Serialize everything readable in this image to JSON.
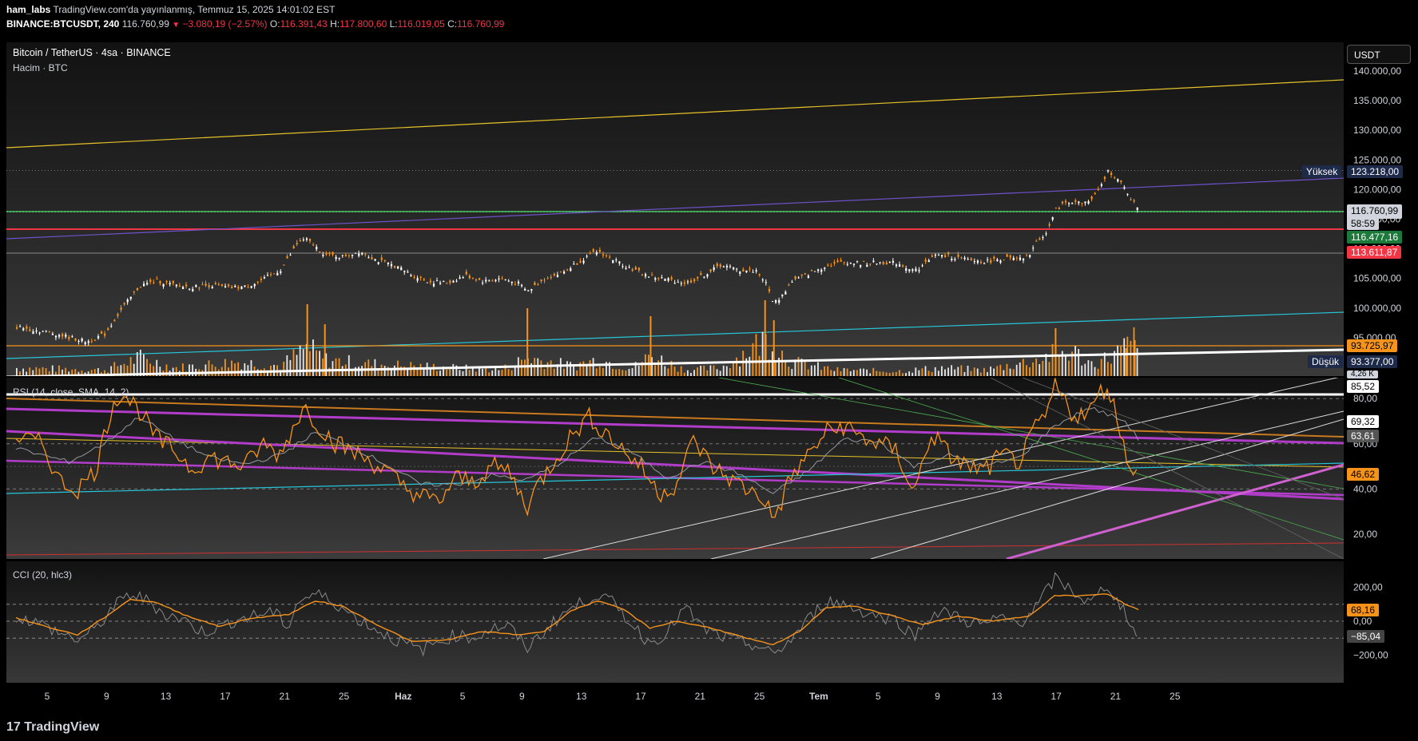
{
  "header": {
    "author": "ham_labs",
    "published": "TradingView.com'da yayınlanmış, Temmuz 15, 2025 14:01:02 EST",
    "symbol": "BINANCE:BTCUSDT, 240",
    "last": "116.760,99",
    "change": "−3.080,19 (−2.57%)",
    "o_label": "O:",
    "o_value": "116.391,43",
    "h_label": "H:",
    "h_value": "117.800,60",
    "l_label": "L:",
    "l_value": "116.019,05",
    "c_label": "C:",
    "c_value": "116.760,99"
  },
  "pane_titles": {
    "main": "Bitcoin / TetherUS · 4sa · BINANCE",
    "volume": "Hacim · BTC",
    "rsi": "RSI (14, close, SMA, 14, 2)",
    "cci": "CCI (20, hlc3)"
  },
  "currency_button": "USDT",
  "logo": "TradingView",
  "colors": {
    "candle_up": "#ffffff",
    "candle_down": "#f7931a",
    "price_line": "#22c55e",
    "resistance": "#f23645",
    "upper_channel": "#e6c229",
    "mid_channel": "#6e52c9",
    "lower_channel": "#26c6da",
    "rsi_line": "#f7931a",
    "rsi_ma": "#9598a1",
    "purple_trend": "#b13cc9"
  },
  "price_labels": {
    "yuksek_tag": "Yüksek",
    "yuksek_value": "123.218,00",
    "last": "116.760,99",
    "countdown": "58:59",
    "green": "116.477,16",
    "red": "113.611,87",
    "orange": "93.725,97",
    "dusuk_tag": "Düşük",
    "dusuk_value": "93.377,00",
    "volume_partial": "4,26 K"
  },
  "rsi_labels": {
    "white": "85,52",
    "light": "69,32",
    "gray": "63,61",
    "orange": "46,62"
  },
  "cci_labels": {
    "orange": "68,16",
    "gray": "−85,04"
  },
  "chart_data": {
    "type": "line",
    "title": "Bitcoin / TetherUS · 4sa · BINANCE",
    "price_axis": {
      "ticks": [
        "140.000,00",
        "135.000,00",
        "130.000,00",
        "125.000,00",
        "120.000,00",
        "115.000,00",
        "110.000,00",
        "105.000,00",
        "100.000,00",
        "95.000,00"
      ],
      "values": [
        140000,
        135000,
        130000,
        125000,
        120000,
        115000,
        110000,
        105000,
        100000,
        95000
      ]
    },
    "rsi_axis": {
      "ticks": [
        "80,00",
        "60,00",
        "40,00",
        "20,00"
      ],
      "values": [
        80,
        60,
        40,
        20
      ]
    },
    "cci_axis": {
      "ticks": [
        "200,00",
        "0,00",
        "−200,00"
      ],
      "values": [
        200,
        0,
        -200
      ]
    },
    "date_ticks": [
      "5",
      "9",
      "13",
      "17",
      "21",
      "25",
      "Haz",
      "5",
      "9",
      "13",
      "17",
      "21",
      "25",
      "Tem",
      "5",
      "9",
      "13",
      "17",
      "21",
      "25"
    ],
    "price_series": [
      [
        0,
        96800
      ],
      [
        4,
        95800
      ],
      [
        8,
        94300
      ],
      [
        10,
        95600
      ],
      [
        12,
        100000
      ],
      [
        14,
        103800
      ],
      [
        16,
        104600
      ],
      [
        18,
        103800
      ],
      [
        20,
        103500
      ],
      [
        22,
        103900
      ],
      [
        24,
        103400
      ],
      [
        26,
        103600
      ],
      [
        28,
        104800
      ],
      [
        30,
        106500
      ],
      [
        32,
        111200
      ],
      [
        33,
        111500
      ],
      [
        35,
        109000
      ],
      [
        37,
        108700
      ],
      [
        39,
        109600
      ],
      [
        41,
        108000
      ],
      [
        43,
        107100
      ],
      [
        45,
        105500
      ],
      [
        47,
        104400
      ],
      [
        49,
        104300
      ],
      [
        51,
        105500
      ],
      [
        53,
        104500
      ],
      [
        55,
        105000
      ],
      [
        57,
        104100
      ],
      [
        58,
        102800
      ],
      [
        60,
        105000
      ],
      [
        62,
        106000
      ],
      [
        64,
        108000
      ],
      [
        66,
        109600
      ],
      [
        68,
        108000
      ],
      [
        70,
        106500
      ],
      [
        72,
        105300
      ],
      [
        74,
        104800
      ],
      [
        76,
        104200
      ],
      [
        78,
        105500
      ],
      [
        80,
        107300
      ],
      [
        82,
        106400
      ],
      [
        84,
        106300
      ],
      [
        85,
        104500
      ],
      [
        86,
        100800
      ],
      [
        87,
        102200
      ],
      [
        88,
        104500
      ],
      [
        90,
        105800
      ],
      [
        92,
        107200
      ],
      [
        94,
        107800
      ],
      [
        96,
        107500
      ],
      [
        98,
        107700
      ],
      [
        100,
        107600
      ],
      [
        102,
        106300
      ],
      [
        103,
        107200
      ],
      [
        104,
        108900
      ],
      [
        106,
        108700
      ],
      [
        108,
        108100
      ],
      [
        110,
        107800
      ],
      [
        112,
        108400
      ],
      [
        114,
        108200
      ],
      [
        115,
        109000
      ],
      [
        116,
        111500
      ],
      [
        117,
        112800
      ],
      [
        118,
        116500
      ],
      [
        119,
        117800
      ],
      [
        120,
        118000
      ],
      [
        121,
        117600
      ],
      [
        122,
        118200
      ],
      [
        123,
        120000
      ],
      [
        124,
        123218
      ],
      [
        125,
        121800
      ],
      [
        126,
        119800
      ],
      [
        127,
        117500
      ],
      [
        127.5,
        116761
      ]
    ],
    "volume_hint": [
      [
        0,
        0.2
      ],
      [
        10,
        0.15
      ],
      [
        14,
        0.45
      ],
      [
        18,
        0.2
      ],
      [
        25,
        0.35
      ],
      [
        30,
        0.25
      ],
      [
        33,
        0.7
      ],
      [
        35,
        0.4
      ],
      [
        40,
        0.3
      ],
      [
        45,
        0.25
      ],
      [
        50,
        0.2
      ],
      [
        55,
        0.15
      ],
      [
        58,
        0.45
      ],
      [
        63,
        0.25
      ],
      [
        66,
        0.4
      ],
      [
        70,
        0.2
      ],
      [
        72,
        0.5
      ],
      [
        76,
        0.15
      ],
      [
        80,
        0.2
      ],
      [
        85,
        0.9
      ],
      [
        86,
        0.75
      ],
      [
        88,
        0.35
      ],
      [
        93,
        0.15
      ],
      [
        100,
        0.12
      ],
      [
        105,
        0.2
      ],
      [
        110,
        0.15
      ],
      [
        116,
        0.4
      ],
      [
        118,
        0.55
      ],
      [
        120,
        0.6
      ],
      [
        122,
        0.3
      ],
      [
        124,
        0.45
      ],
      [
        126,
        0.7
      ],
      [
        127,
        0.9
      ],
      [
        127.5,
        0.3
      ]
    ],
    "rsi_series": [
      [
        0,
        63
      ],
      [
        3,
        60
      ],
      [
        5,
        43
      ],
      [
        7,
        40
      ],
      [
        9,
        48
      ],
      [
        11,
        78
      ],
      [
        12,
        83
      ],
      [
        14,
        75
      ],
      [
        16,
        62
      ],
      [
        18,
        57
      ],
      [
        20,
        49
      ],
      [
        22,
        54
      ],
      [
        24,
        52
      ],
      [
        26,
        50
      ],
      [
        28,
        60
      ],
      [
        30,
        55
      ],
      [
        32,
        72
      ],
      [
        33,
        76
      ],
      [
        34,
        70
      ],
      [
        36,
        61
      ],
      [
        38,
        57
      ],
      [
        40,
        53
      ],
      [
        42,
        48
      ],
      [
        44,
        41
      ],
      [
        46,
        37
      ],
      [
        48,
        34
      ],
      [
        50,
        45
      ],
      [
        52,
        43
      ],
      [
        54,
        50
      ],
      [
        56,
        48
      ],
      [
        58,
        32
      ],
      [
        59,
        40
      ],
      [
        61,
        52
      ],
      [
        63,
        63
      ],
      [
        65,
        72
      ],
      [
        67,
        65
      ],
      [
        69,
        57
      ],
      [
        71,
        50
      ],
      [
        73,
        38
      ],
      [
        75,
        42
      ],
      [
        77,
        62
      ],
      [
        79,
        50
      ],
      [
        81,
        45
      ],
      [
        83,
        40
      ],
      [
        85,
        36
      ],
      [
        86,
        26
      ],
      [
        87,
        35
      ],
      [
        88,
        45
      ],
      [
        90,
        55
      ],
      [
        92,
        65
      ],
      [
        94,
        68
      ],
      [
        96,
        63
      ],
      [
        98,
        60
      ],
      [
        100,
        57
      ],
      [
        102,
        38
      ],
      [
        104,
        65
      ],
      [
        106,
        55
      ],
      [
        108,
        50
      ],
      [
        110,
        48
      ],
      [
        112,
        55
      ],
      [
        114,
        52
      ],
      [
        116,
        68
      ],
      [
        117,
        72
      ],
      [
        118,
        85
      ],
      [
        119,
        80
      ],
      [
        120,
        73
      ],
      [
        122,
        74
      ],
      [
        123,
        82
      ],
      [
        124,
        86
      ],
      [
        125,
        72
      ],
      [
        126,
        58
      ],
      [
        127,
        44
      ],
      [
        127.5,
        47
      ]
    ],
    "rsi_ma_series": [
      [
        0,
        58
      ],
      [
        6,
        52
      ],
      [
        10,
        60
      ],
      [
        14,
        72
      ],
      [
        18,
        62
      ],
      [
        22,
        54
      ],
      [
        26,
        51
      ],
      [
        30,
        55
      ],
      [
        34,
        65
      ],
      [
        38,
        59
      ],
      [
        42,
        51
      ],
      [
        46,
        42
      ],
      [
        50,
        42
      ],
      [
        54,
        46
      ],
      [
        58,
        44
      ],
      [
        62,
        52
      ],
      [
        66,
        63
      ],
      [
        70,
        56
      ],
      [
        74,
        45
      ],
      [
        78,
        52
      ],
      [
        82,
        47
      ],
      [
        86,
        38
      ],
      [
        90,
        48
      ],
      [
        94,
        62
      ],
      [
        98,
        61
      ],
      [
        102,
        50
      ],
      [
        106,
        55
      ],
      [
        110,
        50
      ],
      [
        114,
        54
      ],
      [
        118,
        68
      ],
      [
        122,
        76
      ],
      [
        126,
        70
      ],
      [
        127.5,
        62
      ]
    ],
    "cci_series": [
      [
        0,
        30
      ],
      [
        3,
        -20
      ],
      [
        5,
        -70
      ],
      [
        7,
        -110
      ],
      [
        9,
        -50
      ],
      [
        11,
        80
      ],
      [
        13,
        160
      ],
      [
        15,
        120
      ],
      [
        17,
        40
      ],
      [
        19,
        10
      ],
      [
        21,
        -60
      ],
      [
        23,
        -40
      ],
      [
        25,
        10
      ],
      [
        27,
        30
      ],
      [
        29,
        60
      ],
      [
        31,
        -30
      ],
      [
        32,
        120
      ],
      [
        34,
        160
      ],
      [
        36,
        120
      ],
      [
        38,
        40
      ],
      [
        40,
        -20
      ],
      [
        42,
        -80
      ],
      [
        44,
        -130
      ],
      [
        46,
        -170
      ],
      [
        48,
        -120
      ],
      [
        50,
        -80
      ],
      [
        52,
        -100
      ],
      [
        54,
        -40
      ],
      [
        56,
        -30
      ],
      [
        58,
        -160
      ],
      [
        60,
        -60
      ],
      [
        62,
        40
      ],
      [
        64,
        100
      ],
      [
        66,
        160
      ],
      [
        68,
        100
      ],
      [
        70,
        -20
      ],
      [
        72,
        -130
      ],
      [
        74,
        -60
      ],
      [
        76,
        80
      ],
      [
        78,
        -40
      ],
      [
        80,
        -90
      ],
      [
        82,
        -120
      ],
      [
        84,
        -140
      ],
      [
        86,
        -200
      ],
      [
        88,
        -110
      ],
      [
        90,
        10
      ],
      [
        92,
        120
      ],
      [
        94,
        100
      ],
      [
        96,
        60
      ],
      [
        98,
        30
      ],
      [
        100,
        10
      ],
      [
        102,
        -90
      ],
      [
        104,
        40
      ],
      [
        106,
        50
      ],
      [
        108,
        0
      ],
      [
        110,
        -20
      ],
      [
        112,
        20
      ],
      [
        114,
        -10
      ],
      [
        116,
        90
      ],
      [
        118,
        250
      ],
      [
        120,
        180
      ],
      [
        122,
        100
      ],
      [
        124,
        220
      ],
      [
        125,
        120
      ],
      [
        126,
        60
      ],
      [
        127,
        -60
      ],
      [
        127.5,
        -85
      ]
    ],
    "cci_ma_series": [
      [
        0,
        20
      ],
      [
        4,
        -40
      ],
      [
        7,
        -80
      ],
      [
        10,
        20
      ],
      [
        13,
        130
      ],
      [
        16,
        110
      ],
      [
        19,
        40
      ],
      [
        23,
        -30
      ],
      [
        27,
        20
      ],
      [
        31,
        40
      ],
      [
        34,
        120
      ],
      [
        37,
        90
      ],
      [
        41,
        -20
      ],
      [
        45,
        -120
      ],
      [
        49,
        -110
      ],
      [
        53,
        -60
      ],
      [
        57,
        -80
      ],
      [
        60,
        -60
      ],
      [
        63,
        60
      ],
      [
        66,
        120
      ],
      [
        69,
        70
      ],
      [
        72,
        -40
      ],
      [
        75,
        0
      ],
      [
        79,
        -40
      ],
      [
        83,
        -100
      ],
      [
        86,
        -140
      ],
      [
        89,
        -60
      ],
      [
        92,
        80
      ],
      [
        95,
        90
      ],
      [
        99,
        40
      ],
      [
        103,
        -20
      ],
      [
        107,
        30
      ],
      [
        111,
        0
      ],
      [
        115,
        30
      ],
      [
        118,
        150
      ],
      [
        121,
        150
      ],
      [
        124,
        160
      ],
      [
        126,
        100
      ],
      [
        127.5,
        68
      ]
    ]
  }
}
